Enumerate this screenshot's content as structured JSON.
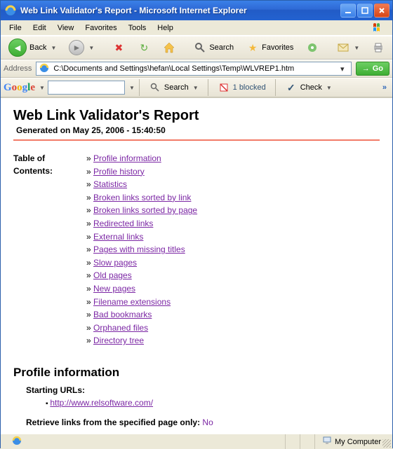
{
  "window": {
    "title": "Web Link Validator's Report - Microsoft Internet Explorer"
  },
  "menu": [
    "File",
    "Edit",
    "View",
    "Favorites",
    "Tools",
    "Help"
  ],
  "nav": {
    "back_label": "Back",
    "search_label": "Search",
    "favorites_label": "Favorites"
  },
  "address": {
    "label": "Address",
    "value": "C:\\Documents and Settings\\hefan\\Local Settings\\Temp\\WLVREP1.htm",
    "go_label": "Go"
  },
  "google": {
    "search_label": "Search",
    "blocked_label": "1 blocked",
    "check_label": "Check",
    "more": "»"
  },
  "report": {
    "title": "Web Link Validator's Report",
    "generated": "Generated on May 25, 2006 - 15:40:50",
    "toc_label": "Table of Contents:",
    "toc": [
      "Profile information",
      "Profile history",
      "Statistics",
      "Broken links sorted by link",
      "Broken links sorted by page",
      "Redirected links",
      "External links",
      "Pages with missing titles",
      "Slow pages",
      "Old pages",
      "New pages",
      "Filename extensions",
      "Bad bookmarks",
      "Orphaned files",
      "Directory tree"
    ],
    "profile_heading": "Profile information",
    "starting_urls_label": "Starting URLs:",
    "starting_url": "http://www.relsoftware.com/",
    "retrieve_label": "Retrieve links from the specified page only:",
    "retrieve_value": "No"
  },
  "status": {
    "zone": "My Computer"
  }
}
